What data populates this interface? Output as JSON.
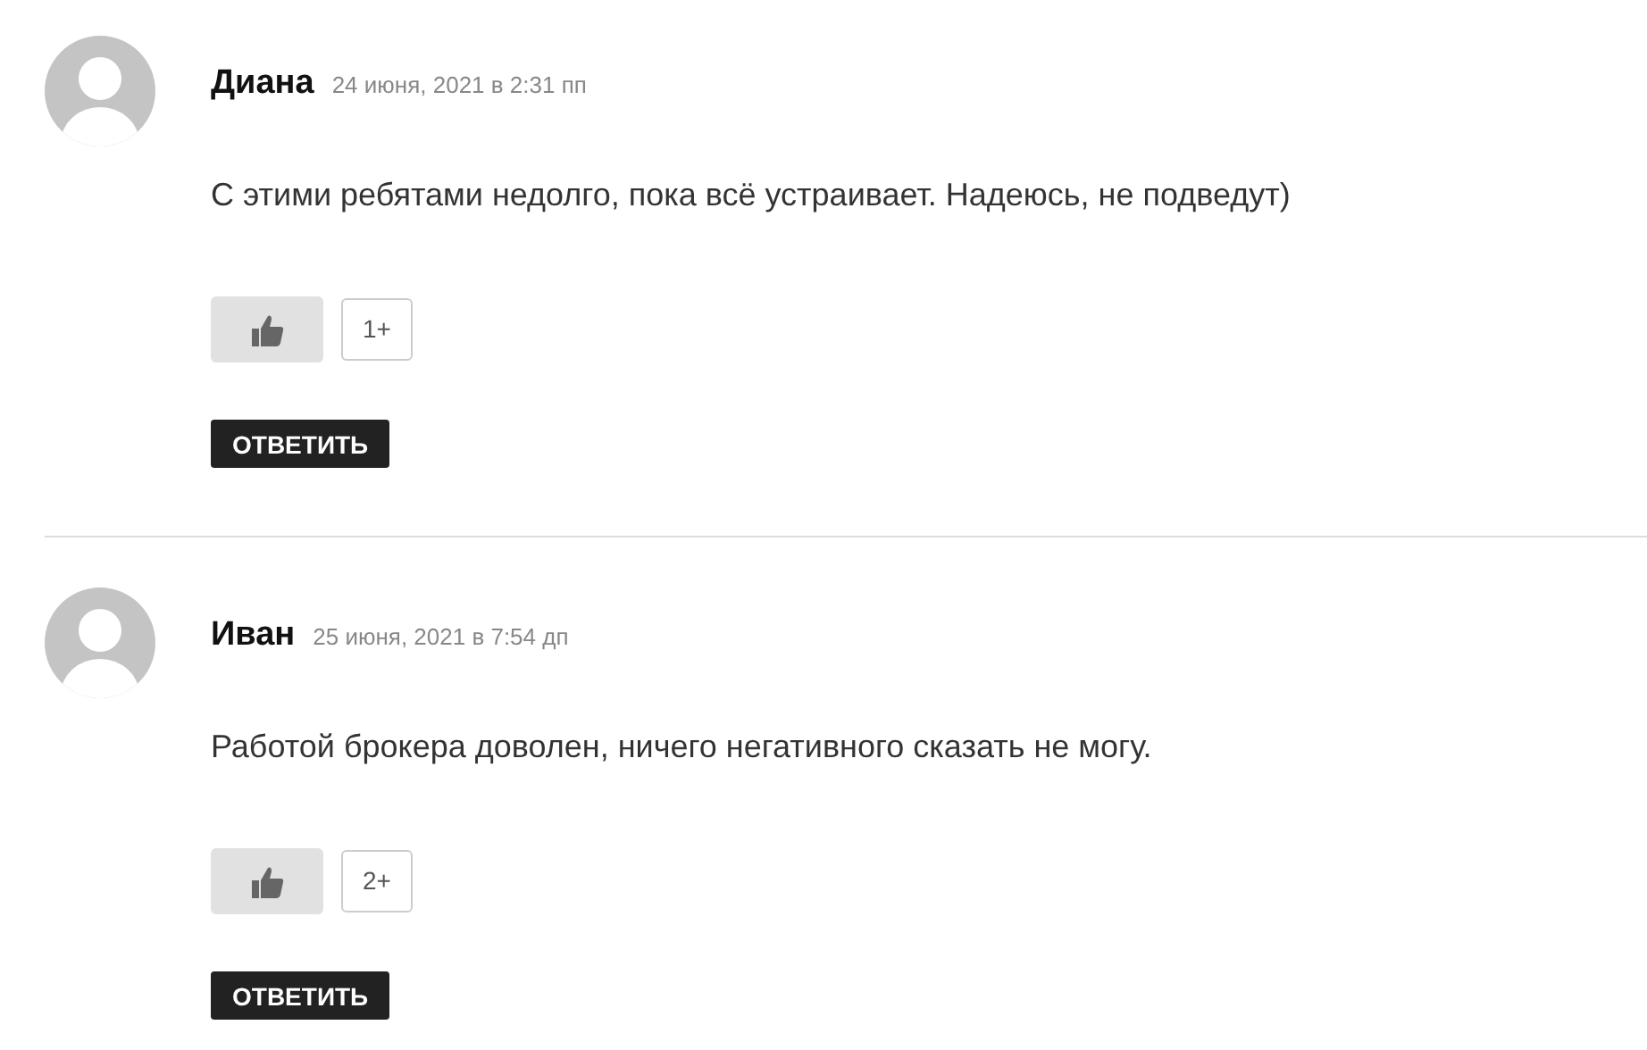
{
  "comments": [
    {
      "author": "Диана",
      "date": "24 июня, 2021 в 2:31 пп",
      "text": "С этими ребятами недолго, пока всё устраивает. Надеюсь, не подведут)",
      "likes": "1+",
      "reply": "ОТВЕТИТЬ"
    },
    {
      "author": "Иван",
      "date": "25 июня, 2021 в 7:54 дп",
      "text": "Работой брокера доволен, ничего негативного сказать не могу.",
      "likes": "2+",
      "reply": "ОТВЕТИТЬ"
    }
  ]
}
